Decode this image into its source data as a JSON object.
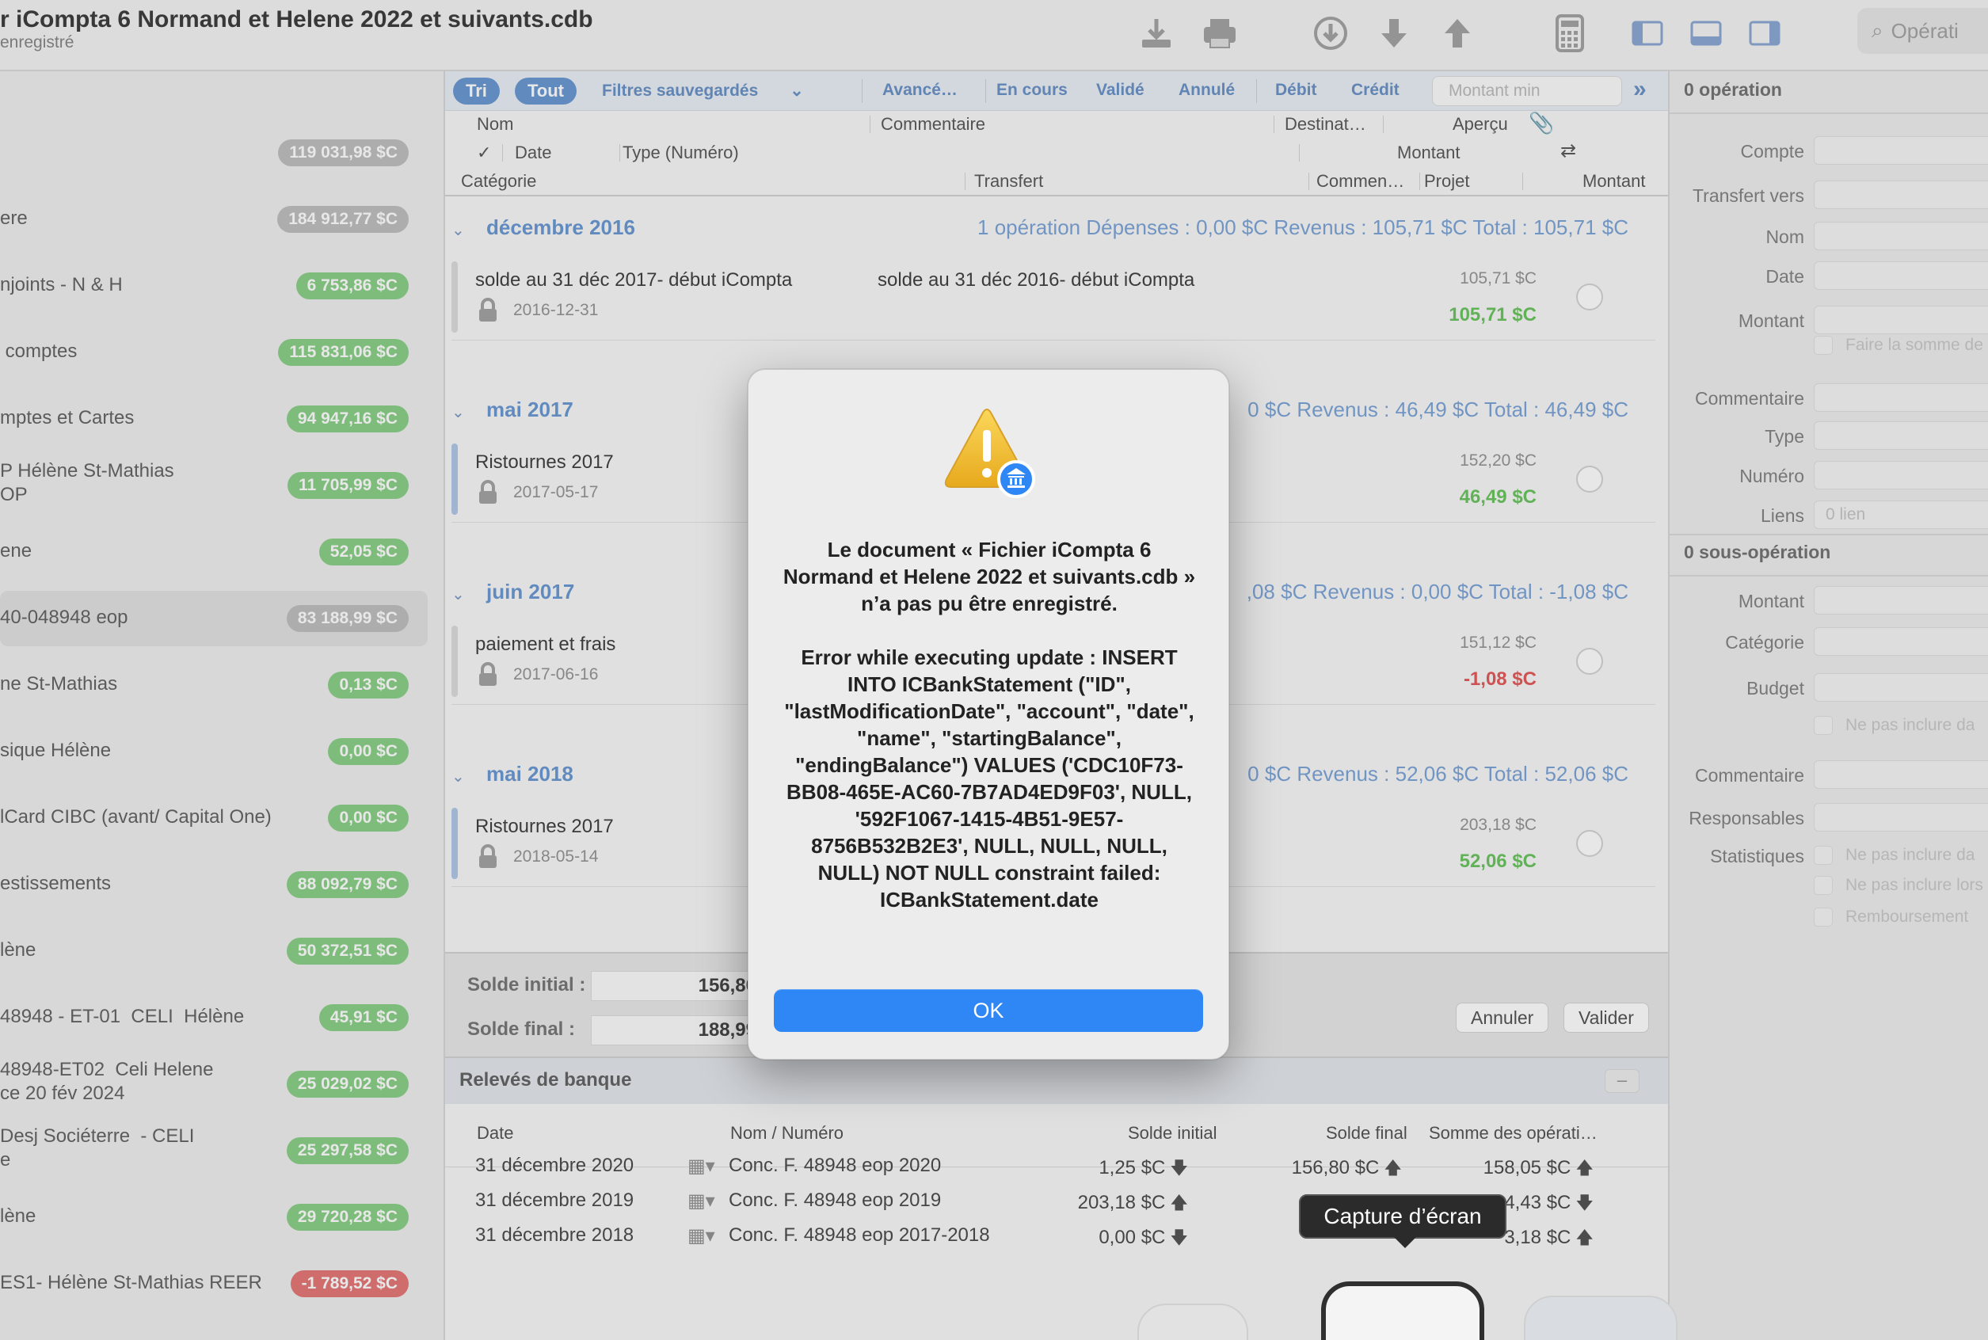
{
  "window": {
    "title": "r iCompta 6 Normand et Helene 2022 et suivants.cdb",
    "subtitle": "enregistré",
    "search_placeholder": "Opérati"
  },
  "toolbar_icons": [
    "download-tray-icon",
    "print-icon",
    "circle-down-icon",
    "arrow-down-icon",
    "arrow-up-icon",
    "calculator-icon",
    "sidebar-left-icon",
    "bottom-panel-icon",
    "sidebar-right-icon"
  ],
  "sidebar": {
    "accounts": [
      {
        "name": "",
        "amount": "119 031,98 $C",
        "color": "gray"
      },
      {
        "name": "ere",
        "amount": "184 912,77 $C",
        "color": "gray"
      },
      {
        "name": "njoints - N & H",
        "amount": "6 753,86 $C",
        "color": "green"
      },
      {
        "name": " comptes",
        "amount": "115 831,06 $C",
        "color": "green"
      },
      {
        "name": "mptes et Cartes",
        "amount": "94 947,16 $C",
        "color": "green"
      },
      {
        "name": "P Hélène St-Mathias\nOP",
        "amount": "11 705,99 $C",
        "color": "green"
      },
      {
        "name": "ene",
        "amount": "52,05 $C",
        "color": "green"
      },
      {
        "name": "40-048948 eop",
        "amount": "83 188,99 $C",
        "color": "gray",
        "selected": true
      },
      {
        "name": "ne St-Mathias",
        "amount": "0,13 $C",
        "color": "green"
      },
      {
        "name": "sique Hélène",
        "amount": "0,00 $C",
        "color": "green"
      },
      {
        "name": "lCard CIBC (avant/ Capital One)",
        "amount": "0,00 $C",
        "color": "green"
      },
      {
        "name": "estissements",
        "amount": "88 092,79 $C",
        "color": "green"
      },
      {
        "name": "lène",
        "amount": "50 372,51 $C",
        "color": "green"
      },
      {
        "name": "48948 - ET-01  CELI  Hélène",
        "amount": "45,91 $C",
        "color": "green"
      },
      {
        "name": "48948-ET02  Celi Helene\nce 20 fév 2024",
        "amount": "25 029,02 $C",
        "color": "green"
      },
      {
        "name": "Desj Sociéterre  - CELI\ne",
        "amount": "25 297,58 $C",
        "color": "green"
      },
      {
        "name": "lène",
        "amount": "29 720,28 $C",
        "color": "green"
      },
      {
        "name": "ES1- Hélène St-Mathias REER",
        "amount": "-1 789,52 $C",
        "color": "red"
      }
    ]
  },
  "filters": {
    "tri": "Tri",
    "tout": "Tout",
    "saved": "Filtres sauvegardés",
    "advanced": "Avancé…",
    "en_cours": "En cours",
    "valide": "Validé",
    "annule": "Annulé",
    "debit": "Débit",
    "credit": "Crédit",
    "montant_min_placeholder": "Montant min"
  },
  "columns": {
    "nom": "Nom",
    "commentaire": "Commentaire",
    "destination": "Destinat…",
    "apercu": "Aperçu",
    "check": "✓",
    "date": "Date",
    "type": "Type (Numéro)",
    "montant": "Montant",
    "categorie": "Catégorie",
    "transfert": "Transfert",
    "commen": "Commen…",
    "projet": "Projet",
    "montant2": "Montant"
  },
  "groups": [
    {
      "month": "décembre 2016",
      "summary": "1 opération   Dépenses : 0,00 $C   Revenus : 105,71 $C   Total : 105,71 $C",
      "op": {
        "name": "solde au 31 déc 2017- début iCompta",
        "comment": "solde au 31 déc 2016- début iCompta",
        "date": "2016-12-31",
        "balance": "105,71 $C",
        "amount": "105,71 $C",
        "sign": "pos"
      }
    },
    {
      "month": "mai 2017",
      "summary": "0 $C   Revenus : 46,49 $C   Total : 46,49 $C",
      "op": {
        "name": "Ristournes 2017",
        "comment": "",
        "date": "2017-05-17",
        "balance": "152,20 $C",
        "amount": "46,49 $C",
        "sign": "pos"
      }
    },
    {
      "month": "juin 2017",
      "summary": ",08 $C   Revenus : 0,00 $C   Total : -1,08 $C",
      "op": {
        "name": "paiement et frais",
        "comment": "",
        "date": "2017-06-16",
        "balance": "151,12 $C",
        "amount": "-1,08 $C",
        "sign": "neg"
      }
    },
    {
      "month": "mai 2018",
      "summary": "0 $C   Revenus : 52,06 $C   Total : 52,06 $C",
      "op": {
        "name": "Ristournes 2017",
        "comment": "",
        "date": "2018-05-14",
        "balance": "203,18 $C",
        "amount": "52,06 $C",
        "sign": "pos"
      }
    }
  ],
  "statement_edit": {
    "solde_initial_label": "Solde initial :",
    "solde_initial_value": "156,80",
    "solde_final_label": "Solde final :",
    "solde_final_value": "188,99",
    "annuler": "Annuler",
    "valider": "Valider"
  },
  "statements": {
    "title": "Relevés de banque",
    "columns": [
      "Date",
      "Nom / Numéro",
      "Solde initial",
      "Solde final",
      "Somme des opérati…"
    ],
    "rows": [
      {
        "date": "31 décembre 2020",
        "name": "Conc.  F. 48948 eop 2020",
        "initial": "1,25 $C",
        "initial_dir": "down",
        "final": "156,80 $C",
        "final_dir": "up",
        "sum": "158,05 $C",
        "sum_dir": "up"
      },
      {
        "date": "31 décembre 2019",
        "name": "Conc.  F. 48948 eop 2019",
        "initial": "203,18 $C",
        "initial_dir": "up",
        "final": "",
        "final_dir": "",
        "sum": "4,43 $C",
        "sum_dir": "down"
      },
      {
        "date": "31 décembre 2018",
        "name": "Conc.  F. 48948 eop 2017-2018",
        "initial": "0,00 $C",
        "initial_dir": "down",
        "final": "",
        "final_dir": "",
        "sum": "3,18 $C",
        "sum_dir": "up"
      }
    ]
  },
  "inspector": {
    "section1_title": "0 opération",
    "section1_fields": [
      "Compte",
      "Transfert vers",
      "Nom",
      "Date",
      "Montant"
    ],
    "sum_checkbox": "Faire la somme de",
    "section1_more": [
      "Commentaire",
      "Type",
      "Numéro",
      "Liens"
    ],
    "liens_value": "0 lien",
    "section2_title": "0 sous-opération",
    "section2_fields": [
      "Montant",
      "Catégorie",
      "Budget"
    ],
    "budget_checkbox": "Ne pas inclure da",
    "section2_more": [
      "Commentaire",
      "Responsables",
      "Statistiques"
    ],
    "stat_checkboxes": [
      "Ne pas inclure da",
      "Ne pas inclure lors",
      "Remboursement"
    ]
  },
  "tooltip": "Capture d’écran",
  "alert": {
    "message": "Le document « Fichier iCompta 6 Normand et Helene 2022 et suivants.cdb » n’a pas pu être enregistré.\n\nError while executing update : INSERT INTO ICBankStatement (\"ID\", \"lastModificationDate\", \"account\", \"date\", \"name\", \"startingBalance\", \"endingBalance\") VALUES ('CDC10F73-BB08-465E-AC60-7B7AD4ED9F03', NULL, '592F1067-1415-4B51-9E57-8756B532B2E3', NULL, NULL, NULL, NULL) NOT NULL constraint failed: ICBankStatement.date",
    "ok": "OK",
    "icon": "warning-bank-icon"
  },
  "colors": {
    "accent": "#2f86f5",
    "badge_green": "#7fcb7c",
    "badge_gray": "#b9b9b9",
    "badge_red": "#e26a6a",
    "positive": "#5cbf4f",
    "negative": "#e04a4a",
    "link_blue": "#5c8fcf"
  }
}
